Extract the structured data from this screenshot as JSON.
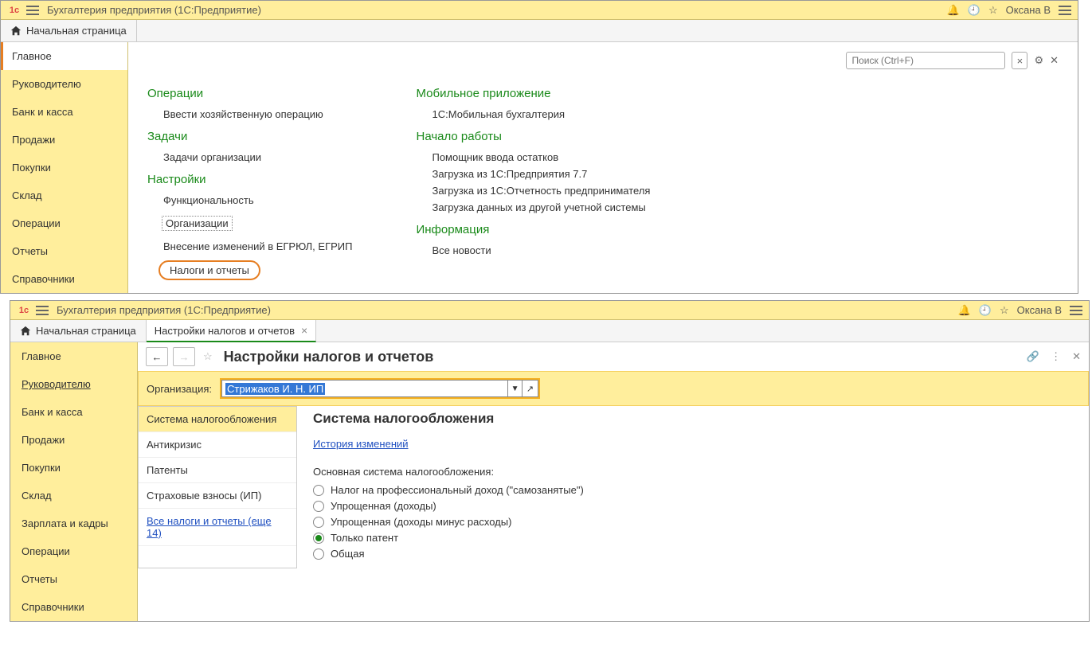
{
  "win1": {
    "title": "Бухгалтерия предприятия  (1С:Предприятие)",
    "user": "Оксана В",
    "home_tab": "Начальная страница",
    "search_placeholder": "Поиск (Ctrl+F)",
    "sidebar": [
      "Главное",
      "Руководителю",
      "Банк и касса",
      "Продажи",
      "Покупки",
      "Склад",
      "Операции",
      "Отчеты",
      "Справочники"
    ],
    "col1": {
      "s1": "Операции",
      "s1_links": [
        "Ввести хозяйственную операцию"
      ],
      "s2": "Задачи",
      "s2_links": [
        "Задачи организации"
      ],
      "s3": "Настройки",
      "s3_links": [
        "Функциональность",
        "Организации",
        "Внесение изменений в ЕГРЮЛ, ЕГРИП"
      ],
      "s3_circled": "Налоги и отчеты"
    },
    "col2": {
      "s1": "Мобильное приложение",
      "s1_links": [
        "1С:Мобильная бухгалтерия"
      ],
      "s2": "Начало работы",
      "s2_links": [
        "Помощник ввода остатков",
        "Загрузка из 1С:Предприятия 7.7",
        "Загрузка из 1С:Отчетность предпринимателя",
        "Загрузка данных из другой учетной системы"
      ],
      "s3": "Информация",
      "s3_links": [
        "Все новости"
      ]
    }
  },
  "win2": {
    "title": "Бухгалтерия предприятия  (1С:Предприятие)",
    "user": "Оксана В",
    "home_tab": "Начальная страница",
    "tab": "Настройки налогов и отчетов",
    "page_title": "Настройки налогов и отчетов",
    "sidebar": [
      "Главное",
      "Руководителю",
      "Банк и касса",
      "Продажи",
      "Покупки",
      "Склад",
      "Зарплата и кадры",
      "Операции",
      "Отчеты",
      "Справочники"
    ],
    "org_label": "Организация:",
    "org_value": "Стрижаков И. Н. ИП",
    "left_tabs": [
      "Система налогообложения",
      "Антикризис",
      "Патенты",
      "Страховые взносы (ИП)"
    ],
    "left_tabs_link": "Все налоги и отчеты (еще 14)",
    "pane_title": "Система налогообложения",
    "history_link": "История изменений",
    "subheader": "Основная система налогообложения:",
    "radios": [
      {
        "label": "Налог на профессиональный доход (\"самозанятые\")",
        "checked": false
      },
      {
        "label": "Упрощенная (доходы)",
        "checked": false
      },
      {
        "label": "Упрощенная (доходы минус расходы)",
        "checked": false
      },
      {
        "label": "Только патент",
        "checked": true
      },
      {
        "label": "Общая",
        "checked": false
      }
    ]
  }
}
